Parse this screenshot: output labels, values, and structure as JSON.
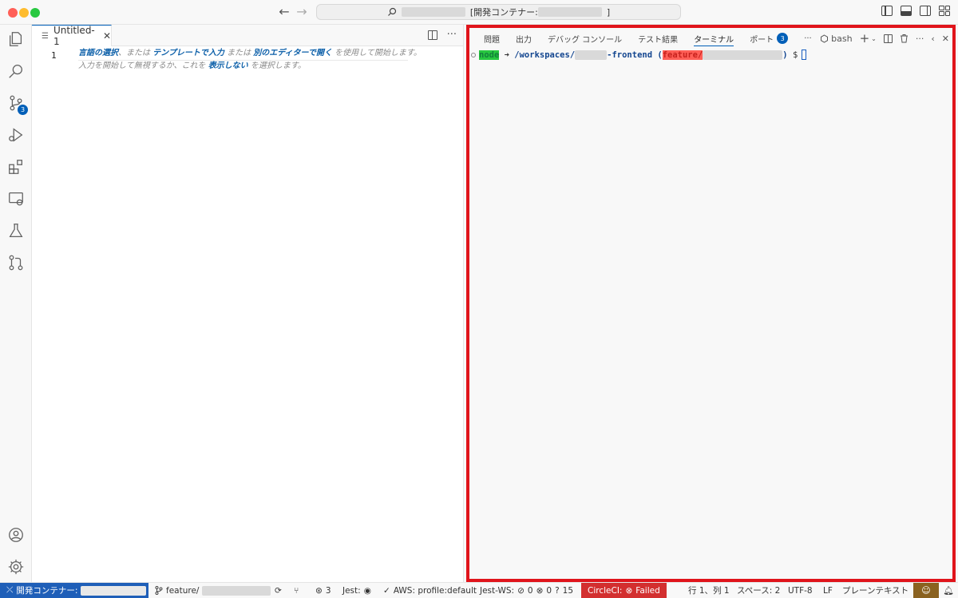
{
  "titlebar": {
    "title_prefix": "[開発コンテナー: ",
    "title_suffix": "]",
    "back_icon": "arrow-left-icon",
    "forward_icon": "arrow-right-icon"
  },
  "activity": {
    "scm_badge": "3"
  },
  "editor": {
    "tab_label": "Untitled-1",
    "line_number": "1",
    "hint": {
      "link1": "言語の選択",
      "t1": "、または ",
      "link2": "テンプレートで入力",
      "t2": " または ",
      "link3": "別のエディターで開く",
      "t3": " を使用して開始します。",
      "t4": "入力を開始して無視するか、これを ",
      "link4": "表示しない",
      "t5": " を選択します。"
    }
  },
  "panel": {
    "tabs": [
      "問題",
      "出力",
      "デバッグ コンソール",
      "テスト結果",
      "ターミナル",
      "ポート"
    ],
    "active_tab": "ターミナル",
    "ports_badge": "3",
    "more": "···",
    "shell_label": "bash",
    "terminal": {
      "user": "node",
      "arrow": "➜",
      "path_prefix": "/workspaces/",
      "path_suffix": "-frontend",
      "branch_open": "(",
      "branch_prefix": "feature/",
      "branch_close": ")",
      "prompt": "$"
    },
    "border_color": "#e0141b"
  },
  "statusbar": {
    "remote_label": "開発コンテナー:",
    "branch_label": "feature/",
    "ports_count": "3",
    "jest_label": "Jest:",
    "aws_label": "AWS: profile:default",
    "jestws_label": "Jest-WS:",
    "jestws_pass": "0",
    "jestws_fail": "0",
    "jestws_unknown": "15",
    "circleci_label": "CircleCI:",
    "circleci_status": "Failed",
    "position": "行 1、列 1",
    "spaces": "スペース: 2",
    "encoding": "UTF-8",
    "eol": "LF",
    "language": "プレーンテキスト"
  }
}
